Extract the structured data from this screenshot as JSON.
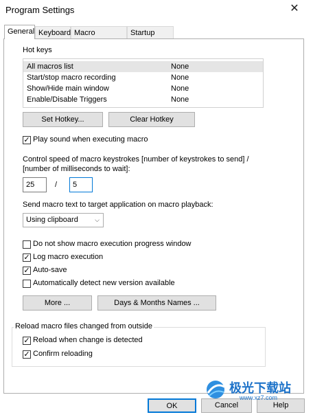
{
  "window": {
    "title": "Program Settings",
    "close_glyph": "✕"
  },
  "tabs": [
    {
      "label": "General"
    },
    {
      "label": "Keyboard"
    },
    {
      "label": "Macro Toolbars"
    },
    {
      "label": "Startup Files"
    }
  ],
  "hotkeys": {
    "section_label": "Hot keys",
    "rows": [
      {
        "action": "All macros list",
        "key": "None"
      },
      {
        "action": "Start/stop macro recording",
        "key": "None"
      },
      {
        "action": "Show/Hide main window",
        "key": "None"
      },
      {
        "action": "Enable/Disable Triggers",
        "key": "None"
      }
    ],
    "set_label": "Set Hotkey...",
    "clear_label": "Clear Hotkey"
  },
  "play_sound": {
    "label": "Play sound when executing macro",
    "checked": true
  },
  "speed": {
    "label_line1": "Control speed of macro keystrokes [number of keystrokes to send] /",
    "label_line2": "[number of milliseconds to wait]:",
    "keystrokes": "25",
    "separator": "/",
    "milliseconds": "5"
  },
  "send_text": {
    "label": "Send macro text to target application on macro playback:",
    "selected": "Using clipboard"
  },
  "options": [
    {
      "label": "Do not show macro execution progress window",
      "checked": false
    },
    {
      "label": "Log macro execution",
      "checked": true
    },
    {
      "label": "Auto-save",
      "checked": true
    },
    {
      "label": "Automatically detect new version available",
      "checked": false
    }
  ],
  "more_label": "More ...",
  "days_label": "Days & Months Names ...",
  "reload": {
    "group_label": "Reload macro files changed from outside",
    "items": [
      {
        "label": "Reload when change is detected",
        "checked": true
      },
      {
        "label": "Confirm reloading",
        "checked": true
      }
    ]
  },
  "footer": {
    "ok": "OK",
    "cancel": "Cancel",
    "help": "Help"
  },
  "watermark": {
    "text": "极光下载站",
    "url": "www.xz7.com"
  },
  "colors": {
    "focus_border": "#0078d7",
    "button_bg": "#e1e1e1",
    "selected_row": "#e5e5e5"
  }
}
